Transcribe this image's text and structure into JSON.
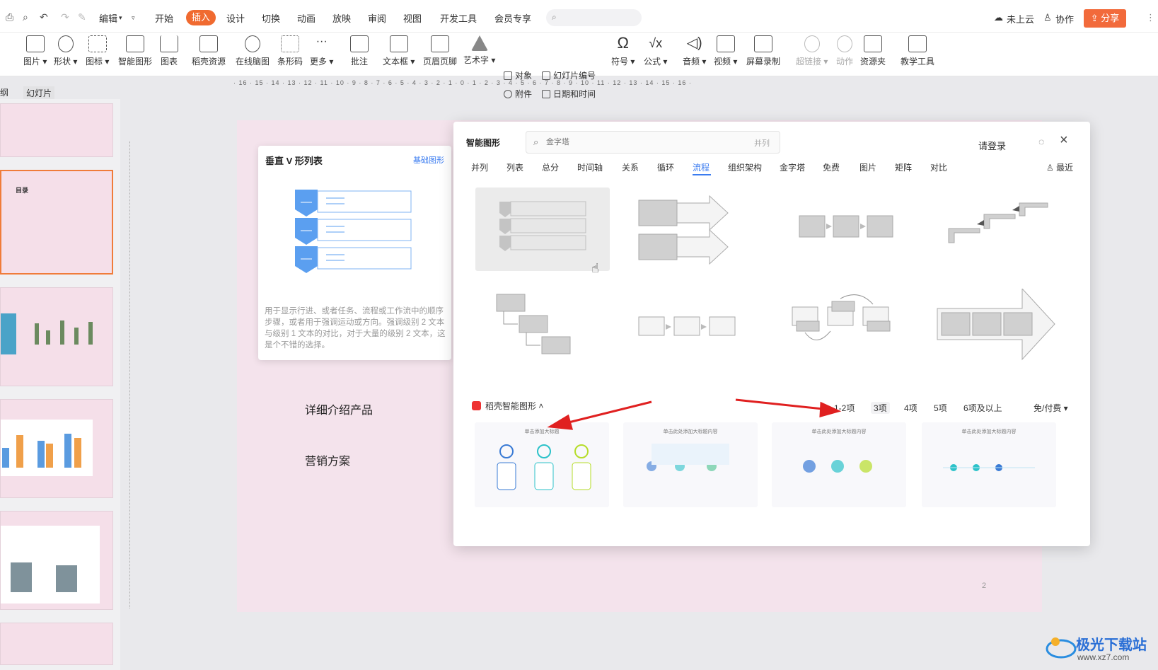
{
  "menubar": {
    "items": [
      "编辑",
      "开始",
      "插入",
      "设计",
      "切换",
      "动画",
      "放映",
      "审阅",
      "视图",
      "开发工具",
      "会员专享"
    ],
    "active": "插入",
    "right": {
      "cloud": "未上云",
      "collab": "协作",
      "share": "分享"
    }
  },
  "ribbon": {
    "buttons": [
      "图片",
      "形状",
      "图标",
      "智能图形",
      "图表",
      "稻壳资源",
      "在线脑图",
      "条形码",
      "更多",
      "批注",
      "文本框",
      "页眉页脚",
      "艺术字",
      "符号",
      "公式",
      "音频",
      "视频",
      "屏幕录制",
      "超链接",
      "动作",
      "资源夹",
      "教学工具"
    ],
    "small": {
      "object": "对象",
      "slide_number": "幻灯片编号",
      "attachment": "附件",
      "datetime": "日期和时间"
    }
  },
  "panel": {
    "tab_outline": "纲",
    "tab_slides": "幻灯片",
    "thumb2_title": "目录"
  },
  "ruler": {
    "h": "· 16 · 15 · 14 · 13 · 12 · 11 · 10 · 9 · 8 · 7 · 6 · 5 · 4 · 3 · 2 · 1 · 0 · 1 · 2 · 3 · 4 · 5 · 6 · 7 · 8 · 9 · 10 · 11 · 12 · 13 · 14 · 15 · 16 ·"
  },
  "slide": {
    "text1": "详细介绍产品",
    "text2": "营销方案",
    "page": "2"
  },
  "preview": {
    "title": "垂直 V 形列表",
    "link": "基础图形",
    "description": "用于显示行进、或者任务、流程或工作流中的顺序步骤，或者用于强调运动或方向。强调级别 2 文本与级别 1 文本的对比，对于大量的级别 2 文本，这是个不错的选择。"
  },
  "dialog": {
    "title": "智能图形",
    "search_placeholder": "金字塔",
    "search_hint": "并列",
    "login": "请登录",
    "tabs": [
      "并列",
      "列表",
      "总分",
      "时间轴",
      "关系",
      "循环",
      "流程",
      "组织架构",
      "金字塔",
      "免费",
      "图片",
      "矩阵",
      "对比"
    ],
    "active_tab": "流程",
    "recent": "最近",
    "daoke": "稻壳智能图形",
    "filters": [
      "1-2项",
      "3项",
      "4项",
      "5项",
      "6项及以上"
    ],
    "active_filter": "3项",
    "price": "免/付费",
    "template_titles": [
      "单击添加大标题",
      "单击此处添加大标题内容",
      "单击此处添加大标题内容",
      "单击此处添加大标题内容"
    ]
  },
  "watermark": {
    "name": "极光下载站",
    "url": "www.xz7.com"
  }
}
